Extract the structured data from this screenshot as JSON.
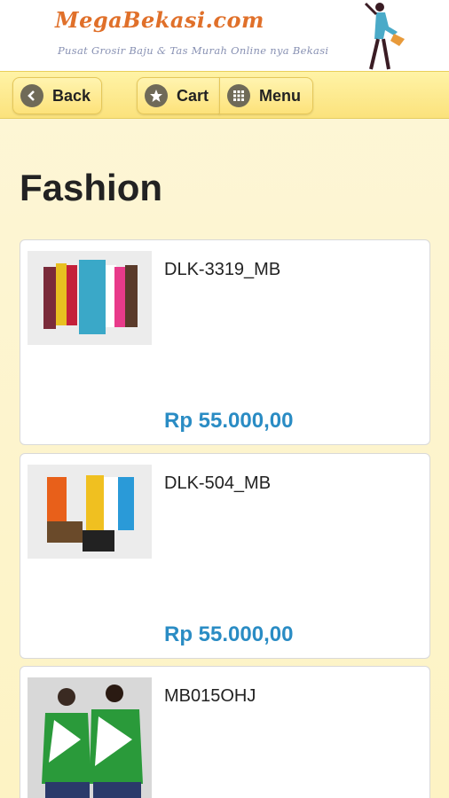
{
  "header": {
    "logo_title": "MegaBekasi.com",
    "logo_subtitle": "Pusat Grosir Baju & Tas Murah Online nya Bekasi"
  },
  "toolbar": {
    "back_label": "Back",
    "back_icon": "chevron-left-icon",
    "cart_label": "Cart",
    "cart_icon": "star-icon",
    "menu_label": "Menu",
    "menu_icon": "grid-icon"
  },
  "page": {
    "title": "Fashion"
  },
  "products": [
    {
      "name": "DLK-3319_MB",
      "price": "Rp 55.000,00"
    },
    {
      "name": "DLK-504_MB",
      "price": "Rp 55.000,00"
    },
    {
      "name": "MB015OHJ",
      "price": ""
    }
  ],
  "colors": {
    "accent_price": "#2a8cc4",
    "toolbar_bg": "#fbe27c",
    "logo_orange": "#e0702a"
  }
}
